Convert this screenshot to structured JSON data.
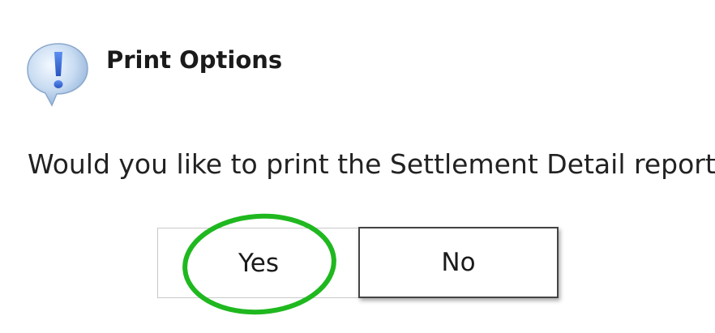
{
  "dialog": {
    "title": "Print Options",
    "message": "Would you like to print the Settlement Detail reports?",
    "icon": "exclamation-speech-bubble-icon"
  },
  "buttons": {
    "yes_label": "Yes",
    "no_label": "No"
  },
  "annotation": {
    "highlight_color": "#1fb81f",
    "highlight_target": "yes-button"
  },
  "colors": {
    "icon_bubble": "#b9d3ee",
    "icon_mark": "#3b6fd6"
  }
}
